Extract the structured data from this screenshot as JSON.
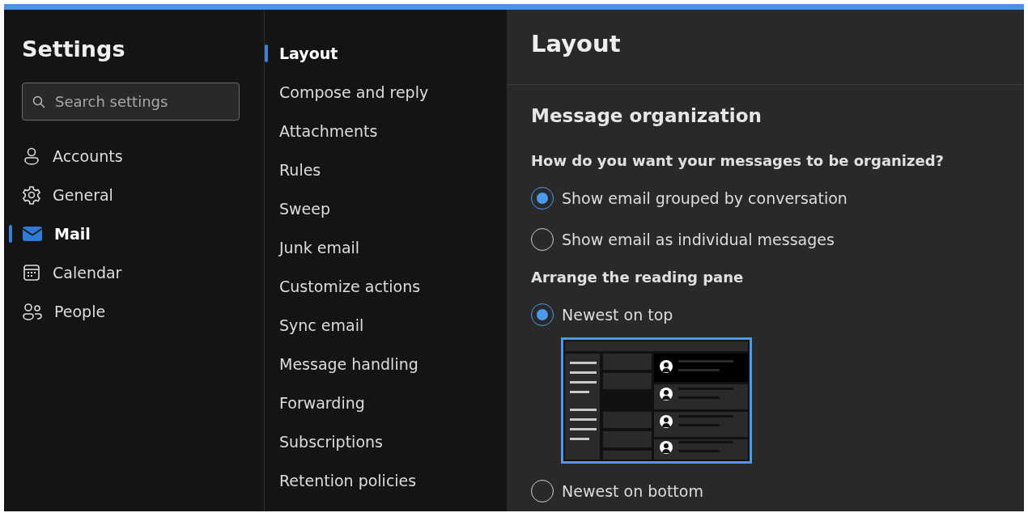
{
  "sidebar": {
    "title": "Settings",
    "search": {
      "placeholder": "Search settings"
    },
    "items": [
      {
        "label": "Accounts",
        "selected": false
      },
      {
        "label": "General",
        "selected": false
      },
      {
        "label": "Mail",
        "selected": true
      },
      {
        "label": "Calendar",
        "selected": false
      },
      {
        "label": "People",
        "selected": false
      }
    ]
  },
  "subnav": {
    "items": [
      {
        "label": "Layout",
        "selected": true
      },
      {
        "label": "Compose and reply",
        "selected": false
      },
      {
        "label": "Attachments",
        "selected": false
      },
      {
        "label": "Rules",
        "selected": false
      },
      {
        "label": "Sweep",
        "selected": false
      },
      {
        "label": "Junk email",
        "selected": false
      },
      {
        "label": "Customize actions",
        "selected": false
      },
      {
        "label": "Sync email",
        "selected": false
      },
      {
        "label": "Message handling",
        "selected": false
      },
      {
        "label": "Forwarding",
        "selected": false
      },
      {
        "label": "Subscriptions",
        "selected": false
      },
      {
        "label": "Retention policies",
        "selected": false
      }
    ]
  },
  "content": {
    "title": "Layout",
    "section": {
      "title": "Message organization",
      "groups": [
        {
          "question": "How do you want your messages to be organized?",
          "options": [
            {
              "label": "Show email grouped by conversation",
              "selected": true
            },
            {
              "label": "Show email as individual messages",
              "selected": false
            }
          ]
        },
        {
          "question": "Arrange the reading pane",
          "options": [
            {
              "label": "Newest on top",
              "selected": true,
              "preview": true
            },
            {
              "label": "Newest on bottom",
              "selected": false
            }
          ]
        }
      ]
    }
  }
}
